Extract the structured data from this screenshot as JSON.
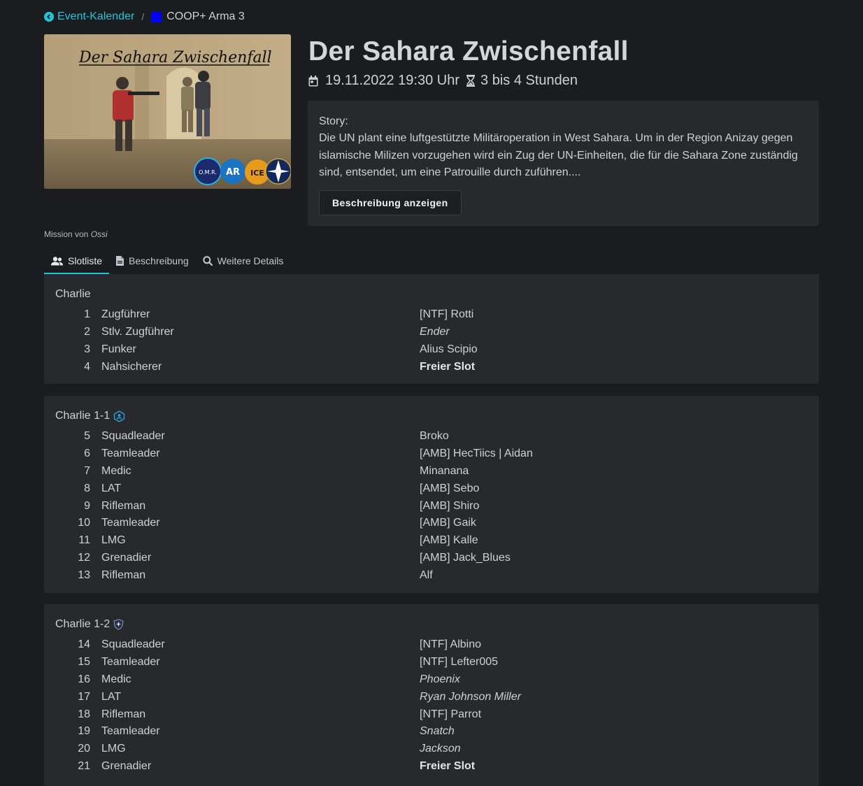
{
  "breadcrumb": {
    "back_label": "Event-Kalender",
    "current_label": "COOP+ Arma 3",
    "separator": "/",
    "square_color": "#0000ff"
  },
  "event": {
    "banner_text": "Der Sahara Zwischenfall",
    "banner_logos": [
      "O.M.R.",
      "AR",
      "ICE",
      "NATO"
    ],
    "title": "Der Sahara Zwischenfall",
    "datetime": "19.11.2022 19:30 Uhr",
    "duration": "3 bis 4 Stunden",
    "mission_by_prefix": "Mission von",
    "mission_by_author": "Ossi"
  },
  "story": {
    "heading": "Story:",
    "text": "Die UN plant eine luftgestützte Militäroperation in West Sahara. Um in der Region Anizay gegen islamische Milizen vorzugehen wird ein Zug der UN-Einheiten, die für die Sahara Zone zuständig sind, entsendet, um eine Patrouille durch zuführen....",
    "button_label": "Beschreibung anzeigen"
  },
  "tabs": [
    {
      "label": "Slotliste",
      "icon": "users-icon",
      "active": true
    },
    {
      "label": "Beschreibung",
      "icon": "file-icon",
      "active": false
    },
    {
      "label": "Weitere Details",
      "icon": "search-icon",
      "active": false
    }
  ],
  "accent_color": "#22c5d6",
  "squads": [
    {
      "name": "Charlie",
      "icon": null,
      "slots": [
        {
          "number": "1",
          "role": "Zugführer",
          "player": "[NTF] Rotti",
          "style": "normal"
        },
        {
          "number": "2",
          "role": "Stlv. Zugführer",
          "player": "Ender",
          "style": "italic"
        },
        {
          "number": "3",
          "role": "Funker",
          "player": "Alius Scipio",
          "style": "normal"
        },
        {
          "number": "4",
          "role": "Nahsicherer",
          "player": "Freier Slot",
          "style": "free"
        }
      ]
    },
    {
      "name": "Charlie 1-1",
      "icon": "ambulance-unit-icon",
      "slots": [
        {
          "number": "5",
          "role": "Squadleader",
          "player": "Broko",
          "style": "normal"
        },
        {
          "number": "6",
          "role": "Teamleader",
          "player": "[AMB] HecTiics | Aidan",
          "style": "normal"
        },
        {
          "number": "7",
          "role": "Medic",
          "player": "Minanana",
          "style": "normal"
        },
        {
          "number": "8",
          "role": "LAT",
          "player": "[AMB] Sebo",
          "style": "normal"
        },
        {
          "number": "9",
          "role": "Rifleman",
          "player": "[AMB] Shiro",
          "style": "normal"
        },
        {
          "number": "10",
          "role": "Teamleader",
          "player": "[AMB] Gaik",
          "style": "normal"
        },
        {
          "number": "11",
          "role": "LMG",
          "player": "[AMB] Kalle",
          "style": "normal"
        },
        {
          "number": "12",
          "role": "Grenadier",
          "player": "[AMB] Jack_Blues",
          "style": "normal"
        },
        {
          "number": "13",
          "role": "Rifleman",
          "player": "Alf",
          "style": "normal"
        }
      ]
    },
    {
      "name": "Charlie 1-2",
      "icon": "ntf-shield-icon",
      "slots": [
        {
          "number": "14",
          "role": "Squadleader",
          "player": "[NTF] Albino",
          "style": "normal"
        },
        {
          "number": "15",
          "role": "Teamleader",
          "player": "[NTF] Lefter005",
          "style": "normal"
        },
        {
          "number": "16",
          "role": "Medic",
          "player": "Phoenix",
          "style": "italic"
        },
        {
          "number": "17",
          "role": "LAT",
          "player": "Ryan Johnson Miller",
          "style": "italic"
        },
        {
          "number": "18",
          "role": "Rifleman",
          "player": "[NTF] Parrot",
          "style": "normal"
        },
        {
          "number": "19",
          "role": "Teamleader",
          "player": "Snatch",
          "style": "italic"
        },
        {
          "number": "20",
          "role": "LMG",
          "player": "Jackson",
          "style": "italic"
        },
        {
          "number": "21",
          "role": "Grenadier",
          "player": "Freier Slot",
          "style": "free"
        }
      ]
    }
  ]
}
